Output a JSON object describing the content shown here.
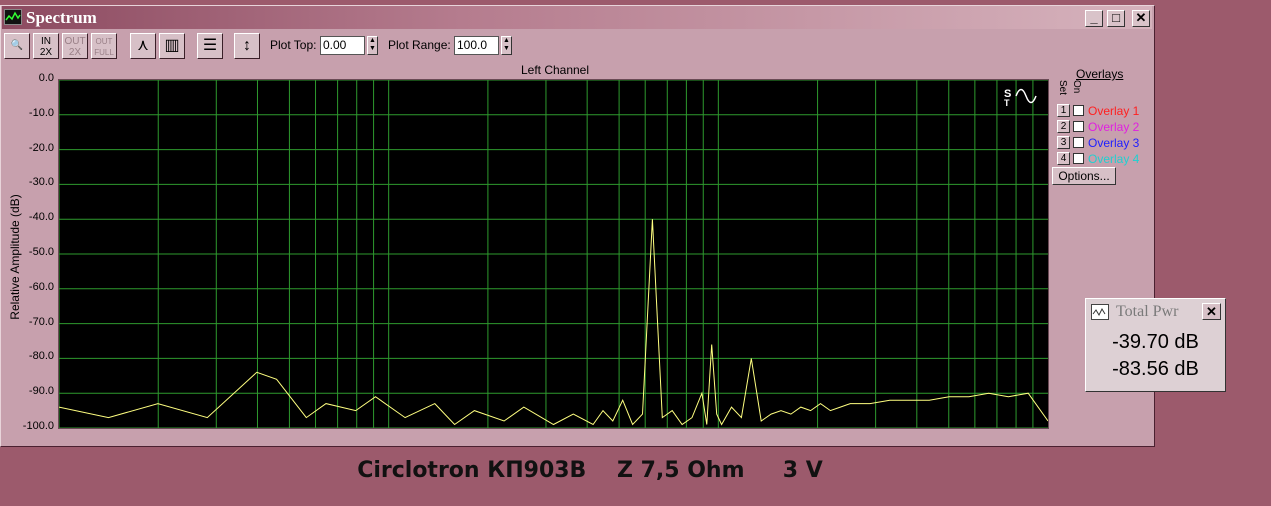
{
  "window": {
    "title": "Spectrum",
    "caption_buttons": [
      "_",
      "□",
      "✕"
    ]
  },
  "toolbar": {
    "buttons": [
      {
        "name": "zoom-button",
        "label": "🔍",
        "enabled": true
      },
      {
        "name": "zoom-in-2x-button",
        "label": "IN 2X",
        "enabled": true
      },
      {
        "name": "zoom-out-2x-button",
        "label": "OUT 2X",
        "enabled": false
      },
      {
        "name": "zoom-out-full-button",
        "label": "OUT FULL",
        "enabled": false
      },
      {
        "name": "line-mode-button",
        "label": "⋏",
        "enabled": true
      },
      {
        "name": "bar-mode-button",
        "label": "▥",
        "enabled": true
      },
      {
        "name": "settings-button",
        "label": "☰",
        "enabled": true
      },
      {
        "name": "autoscale-button",
        "label": "↕",
        "enabled": true
      }
    ],
    "plot_top_label": "Plot Top:",
    "plot_top_value": "0.00",
    "plot_range_label": "Plot Range:",
    "plot_range_value": "100.0"
  },
  "overlays": {
    "title": "Overlays",
    "set_label": "Set",
    "on_label": "On",
    "items": [
      {
        "num": "1",
        "label": "Overlay 1",
        "color": "#ff2020"
      },
      {
        "num": "2",
        "label": "Overlay 2",
        "color": "#e020e0"
      },
      {
        "num": "3",
        "label": "Overlay 3",
        "color": "#2020ff"
      },
      {
        "num": "4",
        "label": "Overlay 4",
        "color": "#20d0d0"
      }
    ],
    "options_label": "Options..."
  },
  "total_power": {
    "title": "Total Pwr",
    "values": [
      "-39.70 dB",
      "-83.56 dB"
    ]
  },
  "caption": "Circlotron КП903В    Z 7,5 Ohm     3 V",
  "chart_data": {
    "type": "line",
    "title": "Left Channel",
    "ylabel": "Relative Amplitude (dB)",
    "xlabel": "",
    "x_scale": "log",
    "ylim": [
      -100,
      0
    ],
    "yticks": [
      "0.0",
      "-10.0",
      "-20.0",
      "-30.0",
      "-40.0",
      "-50.0",
      "-60.0",
      "-70.0",
      "-80.0",
      "-90.0",
      "-100.0"
    ],
    "grid": true,
    "line_color": "#ffff80",
    "grid_color": "#2e9a2e",
    "background": "#000000",
    "series": [
      {
        "x": [
          0.0,
          0.05,
          0.1,
          0.15,
          0.2,
          0.22,
          0.25,
          0.27,
          0.3,
          0.32,
          0.35,
          0.38,
          0.4,
          0.42,
          0.45,
          0.47,
          0.5,
          0.52,
          0.54,
          0.55,
          0.56,
          0.57,
          0.58,
          0.59,
          0.6,
          0.61,
          0.62,
          0.63,
          0.64,
          0.65,
          0.655,
          0.66,
          0.665,
          0.67,
          0.68,
          0.69,
          0.7,
          0.71,
          0.72,
          0.73,
          0.74,
          0.75,
          0.76,
          0.77,
          0.78,
          0.79,
          0.8,
          0.82,
          0.84,
          0.86,
          0.88,
          0.9,
          0.92,
          0.94,
          0.96,
          0.98,
          1.0
        ],
        "y": [
          -94,
          -97,
          -93,
          -97,
          -84,
          -86,
          -97,
          -93,
          -95,
          -91,
          -97,
          -93,
          -99,
          -95,
          -98,
          -94,
          -99,
          -96,
          -99,
          -95,
          -98,
          -92,
          -99,
          -96,
          -40,
          -97,
          -95,
          -99,
          -97,
          -90,
          -99,
          -76,
          -96,
          -99,
          -94,
          -97,
          -80,
          -98,
          -96,
          -95,
          -96,
          -94,
          -95,
          -93,
          -95,
          -94,
          -93,
          -93,
          -92,
          -92,
          -92,
          -91,
          -91,
          -90,
          -91,
          -90,
          -98
        ]
      }
    ]
  }
}
